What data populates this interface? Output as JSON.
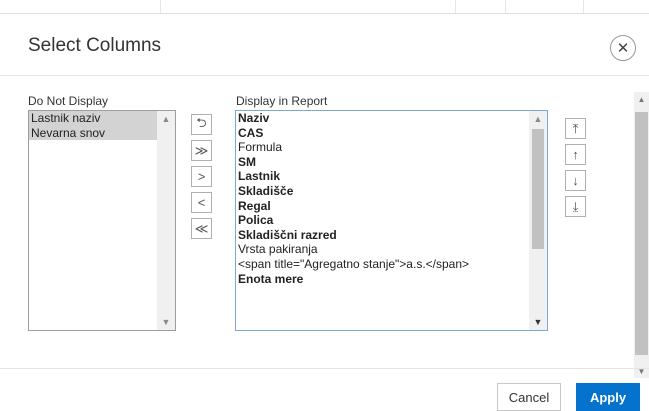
{
  "dialog": {
    "title": "Select Columns",
    "close_icon": "close-icon"
  },
  "left_list": {
    "label": "Do Not Display",
    "items": [
      "Lastnik naziv",
      "Nevarna snov"
    ]
  },
  "right_list": {
    "label": "Display in Report",
    "items": [
      {
        "text": "Naziv",
        "bold": true
      },
      {
        "text": "CAS",
        "bold": true
      },
      {
        "text": "Formula",
        "bold": false
      },
      {
        "text": "SM",
        "bold": true
      },
      {
        "text": "Lastnik",
        "bold": true
      },
      {
        "text": "Skladišče",
        "bold": true
      },
      {
        "text": "Regal",
        "bold": true
      },
      {
        "text": "Polica",
        "bold": true
      },
      {
        "text": "Skladiščni razred",
        "bold": true
      },
      {
        "text": "Vrsta pakiranja",
        "bold": false
      },
      {
        "text": "<span title=\"Agregatno stanje\">a.s.</span>",
        "bold": false
      },
      {
        "text": "Enota mere",
        "bold": true
      }
    ]
  },
  "move_buttons": {
    "reset": "⮌",
    "move_all": "≫",
    "move": ">",
    "remove": "<",
    "remove_all": "≪"
  },
  "order_buttons": {
    "top": "⤒",
    "up": "↑",
    "down": "↓",
    "bottom": "⤓"
  },
  "footer": {
    "cancel_label": "Cancel",
    "apply_label": "Apply"
  },
  "colors": {
    "apply": "#0572ce",
    "selected_row": "#d3d3d3",
    "focus_border": "#7ea7d8"
  }
}
